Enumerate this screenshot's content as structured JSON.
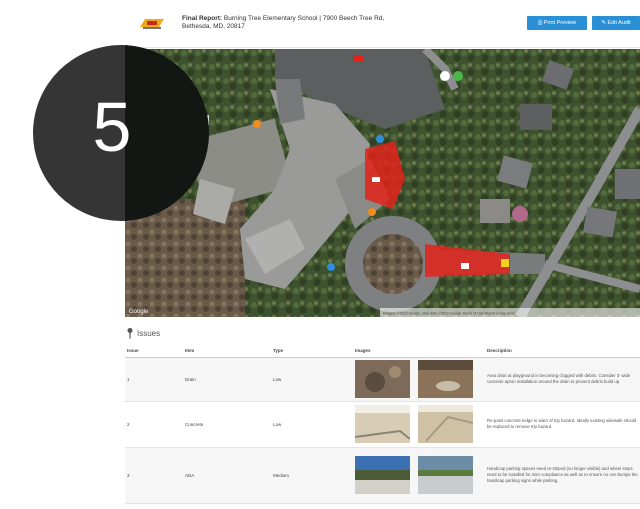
{
  "header": {
    "title_bold": "Final Report:",
    "title_rest": "Burning Tree Elementary School | 7900 Beech Tree Rd,",
    "title_line2": "Bethesda, MD, 20817",
    "print_button": "⎙ Print Preview",
    "edit_button": "✎ Edit Audit"
  },
  "map": {
    "attribution": "Google",
    "copyright": "Imagery ©2018 Google, Map data ©2018 Google  Terms of Use  Report a map error",
    "marker_colors": {
      "red": "#e2231a",
      "orange": "#f28c1c",
      "blue": "#2d8fdc",
      "green": "#4cb748",
      "yellow": "#f2d21b",
      "white": "#ffffff"
    }
  },
  "overlay": {
    "step_number": "5"
  },
  "issues": {
    "heading": "Issues",
    "columns": [
      "Issue",
      "Item",
      "Type",
      "Images",
      "Description"
    ],
    "rows": [
      {
        "issue": "1",
        "item": "Drain",
        "type": "Low",
        "description": "Area drain at playground is becoming clogged with debris. Consider 3' wide concrete apron installation around the drain to prevent debris build up."
      },
      {
        "issue": "2",
        "item": "Concrete",
        "type": "Low",
        "description": "Re-paint concrete ledge to warn of trip hazard. Ideally existing sidewalk should be replaced to remove trip hazard."
      },
      {
        "issue": "3",
        "item": "ADA",
        "type": "Medium",
        "description": "Handicap parking spaces need re-striped (no longer visible) and wheel stops need to be installed for ADA compliance as well as to ensure no one bumps the handicap parking signs while parking."
      }
    ]
  }
}
